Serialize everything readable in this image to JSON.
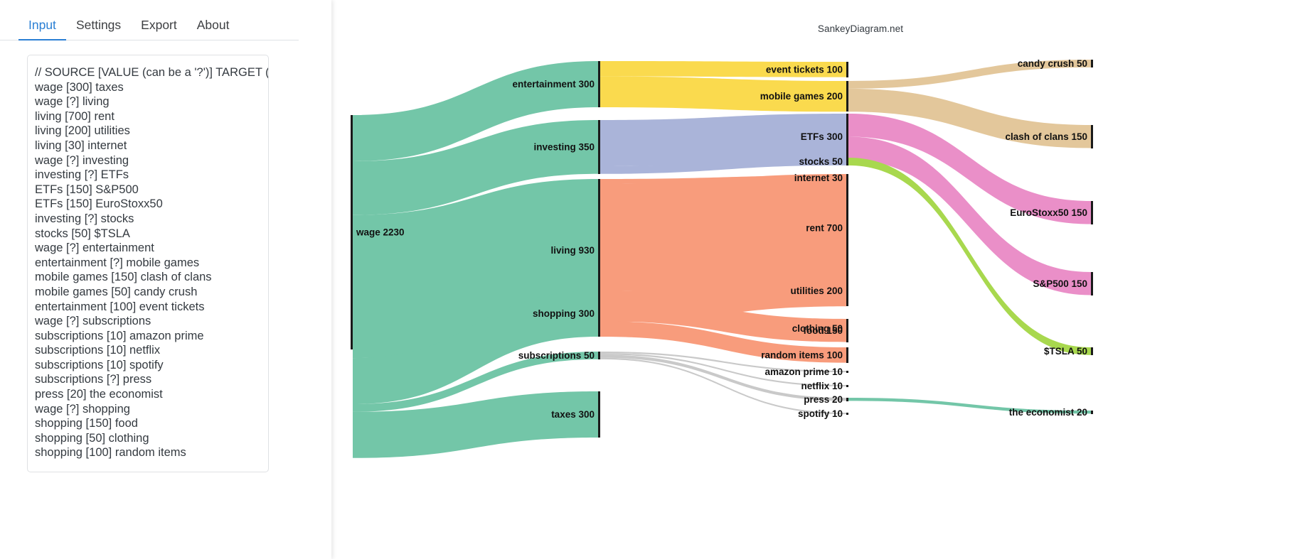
{
  "app": {
    "title": "SankeyDiagram.net"
  },
  "tabs": [
    {
      "label": "Input",
      "active": true
    },
    {
      "label": "Settings",
      "active": false
    },
    {
      "label": "Export",
      "active": false
    },
    {
      "label": "About",
      "active": false
    }
  ],
  "editor": {
    "lines": [
      "// SOURCE [VALUE (can be a '?')] TARGET ([COLOR])",
      "wage [300] taxes",
      "wage [?] living",
      "living [700] rent",
      "living [200] utilities",
      "living [30] internet",
      "wage [?] investing",
      "investing [?] ETFs",
      "ETFs [150] S&P500",
      "ETFs [150] EuroStoxx50",
      "investing [?] stocks",
      "stocks [50] $TSLA",
      "wage [?] entertainment",
      "entertainment [?] mobile games",
      "mobile games [150] clash of clans",
      "mobile games [50] candy crush",
      "entertainment [100] event tickets",
      "wage [?] subscriptions",
      "subscriptions [10] amazon prime",
      "subscriptions [10] netflix",
      "subscriptions [10] spotify",
      "subscriptions [?] press",
      "press [20] the economist",
      "wage [?] shopping",
      "shopping [150] food",
      "shopping [50] clothing",
      "shopping [100] random items"
    ]
  },
  "chart_data": {
    "type": "sankey",
    "title": "SankeyDiagram.net",
    "nodes": [
      {
        "id": "wage",
        "label": "wage 2230",
        "value": 2230,
        "column": 0
      },
      {
        "id": "entertainment",
        "label": "entertainment 300",
        "value": 300,
        "column": 1
      },
      {
        "id": "investing",
        "label": "investing 350",
        "value": 350,
        "column": 1
      },
      {
        "id": "living",
        "label": "living 930",
        "value": 930,
        "column": 1
      },
      {
        "id": "shopping",
        "label": "shopping 300",
        "value": 300,
        "column": 1
      },
      {
        "id": "subscriptions",
        "label": "subscriptions 50",
        "value": 50,
        "column": 1
      },
      {
        "id": "taxes",
        "label": "taxes 300",
        "value": 300,
        "column": 1
      },
      {
        "id": "event tickets",
        "label": "event tickets 100",
        "value": 100,
        "column": 2
      },
      {
        "id": "mobile games",
        "label": "mobile games 200",
        "value": 200,
        "column": 2
      },
      {
        "id": "ETFs",
        "label": "ETFs 300",
        "value": 300,
        "column": 2
      },
      {
        "id": "stocks",
        "label": "stocks 50",
        "value": 50,
        "column": 2
      },
      {
        "id": "internet",
        "label": "internet 30",
        "value": 30,
        "column": 2
      },
      {
        "id": "rent",
        "label": "rent 700",
        "value": 700,
        "column": 2
      },
      {
        "id": "utilities",
        "label": "utilities 200",
        "value": 200,
        "column": 2
      },
      {
        "id": "clothing",
        "label": "clothing 50",
        "value": 50,
        "column": 2
      },
      {
        "id": "food",
        "label": "food 150",
        "value": 150,
        "column": 2
      },
      {
        "id": "random items",
        "label": "random items 100",
        "value": 100,
        "column": 2
      },
      {
        "id": "amazon prime",
        "label": "amazon prime 10",
        "value": 10,
        "column": 2
      },
      {
        "id": "netflix",
        "label": "netflix 10",
        "value": 10,
        "column": 2
      },
      {
        "id": "press",
        "label": "press 20",
        "value": 20,
        "column": 2
      },
      {
        "id": "spotify",
        "label": "spotify 10",
        "value": 10,
        "column": 2
      },
      {
        "id": "candy crush",
        "label": "candy crush 50",
        "value": 50,
        "column": 3
      },
      {
        "id": "clash of clans",
        "label": "clash of clans 150",
        "value": 150,
        "column": 3
      },
      {
        "id": "EuroStoxx50",
        "label": "EuroStoxx50 150",
        "value": 150,
        "column": 3
      },
      {
        "id": "S&P500",
        "label": "S&P500 150",
        "value": 150,
        "column": 3
      },
      {
        "id": "$TSLA",
        "label": "$TSLA 50",
        "value": 50,
        "column": 3
      },
      {
        "id": "the economist",
        "label": "the economist 20",
        "value": 20,
        "column": 3
      }
    ],
    "links": [
      {
        "source": "wage",
        "target": "taxes",
        "value": 300
      },
      {
        "source": "wage",
        "target": "living",
        "value": 930
      },
      {
        "source": "living",
        "target": "rent",
        "value": 700
      },
      {
        "source": "living",
        "target": "utilities",
        "value": 200
      },
      {
        "source": "living",
        "target": "internet",
        "value": 30
      },
      {
        "source": "wage",
        "target": "investing",
        "value": 350
      },
      {
        "source": "investing",
        "target": "ETFs",
        "value": 300
      },
      {
        "source": "ETFs",
        "target": "S&P500",
        "value": 150
      },
      {
        "source": "ETFs",
        "target": "EuroStoxx50",
        "value": 150
      },
      {
        "source": "investing",
        "target": "stocks",
        "value": 50
      },
      {
        "source": "stocks",
        "target": "$TSLA",
        "value": 50
      },
      {
        "source": "wage",
        "target": "entertainment",
        "value": 300
      },
      {
        "source": "entertainment",
        "target": "mobile games",
        "value": 200
      },
      {
        "source": "mobile games",
        "target": "clash of clans",
        "value": 150
      },
      {
        "source": "mobile games",
        "target": "candy crush",
        "value": 50
      },
      {
        "source": "entertainment",
        "target": "event tickets",
        "value": 100
      },
      {
        "source": "wage",
        "target": "subscriptions",
        "value": 50
      },
      {
        "source": "subscriptions",
        "target": "amazon prime",
        "value": 10
      },
      {
        "source": "subscriptions",
        "target": "netflix",
        "value": 10
      },
      {
        "source": "subscriptions",
        "target": "spotify",
        "value": 10
      },
      {
        "source": "subscriptions",
        "target": "press",
        "value": 20
      },
      {
        "source": "press",
        "target": "the economist",
        "value": 20
      },
      {
        "source": "wage",
        "target": "shopping",
        "value": 300
      },
      {
        "source": "shopping",
        "target": "food",
        "value": 150
      },
      {
        "source": "shopping",
        "target": "clothing",
        "value": 50
      },
      {
        "source": "shopping",
        "target": "random items",
        "value": 100
      }
    ],
    "colors": {
      "green": "#73c6a8",
      "yellow": "#fada4e",
      "blue": "#aab4d9",
      "salmon": "#f89c7c",
      "tan": "#e3c79b",
      "pink": "#ea8fc8",
      "lime": "#a8d84e",
      "grey": "#c9c9c9"
    }
  }
}
